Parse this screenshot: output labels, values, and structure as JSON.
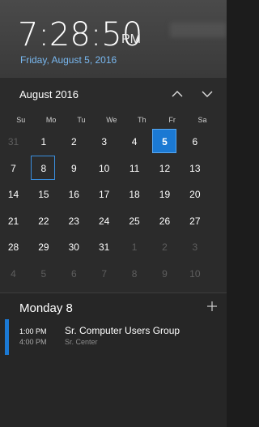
{
  "clock": {
    "time": "7:28:50",
    "ampm": "PM",
    "date": "Friday, August 5, 2016"
  },
  "calendar": {
    "month_label": "August 2016",
    "weekdays": [
      "Su",
      "Mo",
      "Tu",
      "We",
      "Th",
      "Fr",
      "Sa"
    ],
    "weeks": [
      [
        "31",
        "1",
        "2",
        "3",
        "4",
        "5",
        "6"
      ],
      [
        "7",
        "8",
        "9",
        "10",
        "11",
        "12",
        "13"
      ],
      [
        "14",
        "15",
        "16",
        "17",
        "18",
        "19",
        "20"
      ],
      [
        "21",
        "22",
        "23",
        "24",
        "25",
        "26",
        "27"
      ],
      [
        "28",
        "29",
        "30",
        "31",
        "1",
        "2",
        "3"
      ],
      [
        "4",
        "5",
        "6",
        "7",
        "8",
        "9",
        "10"
      ]
    ],
    "today": "5",
    "selected": "8"
  },
  "agenda": {
    "title": "Monday 8",
    "events": [
      {
        "start": "1:00 PM",
        "end": "4:00 PM",
        "title": "Sr. Computer Users Group",
        "location": "Sr. Center"
      }
    ]
  },
  "colors": {
    "accent": "#1b79d3",
    "date_link": "#79b8f0",
    "background": "#262626"
  },
  "icons": {
    "prev": "chevron-up-icon",
    "next": "chevron-down-icon",
    "add": "plus-icon"
  }
}
